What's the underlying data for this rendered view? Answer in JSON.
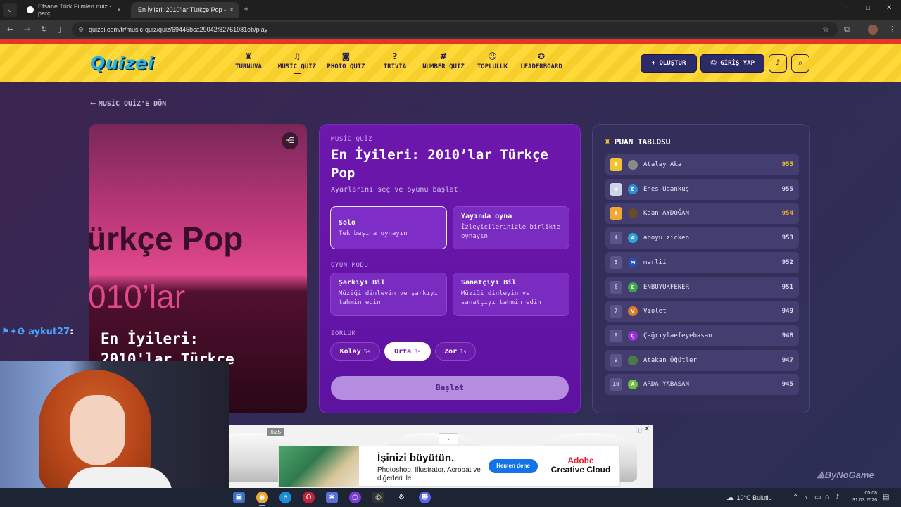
{
  "browser": {
    "tabs": [
      {
        "title": "Efsane Türk Filmleri quiz - parç",
        "close": "×"
      },
      {
        "title": "En İyileri: 2010'lar Türkçe Pop -",
        "close": "×"
      }
    ],
    "tab_dropdown_icon": "chevron-down-icon",
    "new_tab": "+",
    "window_controls": [
      "–",
      "□",
      "✕"
    ],
    "url": "quizei.com/tr/music-quiz/quiz/69445bca29042f82761981eb/play"
  },
  "site": {
    "logo": "Quizei",
    "nav": [
      {
        "label": "TURNUVA",
        "icon": "trophy-icon",
        "glyph": "♜"
      },
      {
        "label": "MUSİC QUİZ",
        "icon": "music-icon",
        "glyph": "♫",
        "active": true
      },
      {
        "label": "PHOTO QUİZ",
        "icon": "camera-icon",
        "glyph": "◙"
      },
      {
        "label": "TRİVİA",
        "icon": "question-icon",
        "glyph": "?"
      },
      {
        "label": "NUMBER QUİZ",
        "icon": "hash-icon",
        "glyph": "#"
      },
      {
        "label": "TOPLULUK",
        "icon": "users-icon",
        "glyph": "☺"
      },
      {
        "label": "LEADERBOARD",
        "icon": "award-icon",
        "glyph": "✪"
      }
    ],
    "create_button": "+ OLUŞTUR",
    "login_button": "GİRİŞ YAP",
    "colors": {
      "header_yellow": "#ffd83a",
      "accent_purple": "#6d17ad",
      "logo_blue": "#24b6e8"
    }
  },
  "page": {
    "back_link": "MUSİC QUİZ'E DÖN",
    "cover": {
      "line1": "ürkçe Pop",
      "line2": "010’lar",
      "title_line1": "En İyileri:",
      "title_line2": "2010'lar Türkçe"
    },
    "setup": {
      "kicker": "MUSİC QUİZ",
      "title": "En İyileri: 2010’lar Türkçe Pop",
      "subtitle": "Ayarlarını seç ve oyunu başlat.",
      "play_modes": [
        {
          "title": "Solo",
          "desc": "Tek başına oynayın",
          "selected": true
        },
        {
          "title": "Yayında oyna",
          "desc": "İzleyicilerinizle birlikte oynayın",
          "selected": false
        }
      ],
      "game_mode_label": "OYUN MODU",
      "game_modes": [
        {
          "title": "Şarkıyı Bil",
          "desc": "Müziği dinleyin ve şarkıyı tahmin edin"
        },
        {
          "title": "Sanatçıyı Bil",
          "desc": "Müziği dinleyin ve sanatçıyı tahmin edin"
        }
      ],
      "difficulty_label": "ZORLUK",
      "difficulties": [
        {
          "label": "Kolay",
          "time": "5s",
          "selected": false
        },
        {
          "label": "Orta",
          "time": "3s",
          "selected": true
        },
        {
          "label": "Zor",
          "time": "1s",
          "selected": false
        }
      ],
      "start_button": "Başlat"
    },
    "leaderboard": {
      "title": "PUAN TABLOSU",
      "rows": [
        {
          "rank": "",
          "rank_icon": "trophy-gold",
          "avatar": "",
          "avatar_color": "#8a8a8a",
          "name": "Atalay Aka",
          "score": "955",
          "highlight": "#f2c230"
        },
        {
          "rank": "",
          "rank_icon": "trophy-silver",
          "avatar": "E",
          "avatar_color": "#2f8fd8",
          "name": "Enes Ugankuş",
          "score": "955",
          "highlight": "#dcd9f0"
        },
        {
          "rank": "",
          "rank_icon": "trophy-bronze",
          "avatar": "",
          "avatar_color": "#6a4a2a",
          "name": "Kaan AYDOĞAN",
          "score": "954",
          "highlight": "#f2a830"
        },
        {
          "rank": "4",
          "avatar": "A",
          "avatar_color": "#2aa7d8",
          "name": "apoyu zicken",
          "score": "953"
        },
        {
          "rank": "5",
          "avatar": "M",
          "avatar_color": "#2a4fb0",
          "name": "merlii",
          "score": "952"
        },
        {
          "rank": "6",
          "avatar": "E",
          "avatar_color": "#39a84a",
          "name": "ENBUYUKFENER",
          "score": "951"
        },
        {
          "rank": "7",
          "avatar": "V",
          "avatar_color": "#e07a2a",
          "name": "Violet",
          "score": "949"
        },
        {
          "rank": "8",
          "avatar": "Ç",
          "avatar_color": "#9a2fd0",
          "name": "Çağrıylaefeyebasan",
          "score": "948"
        },
        {
          "rank": "9",
          "avatar": "",
          "avatar_color": "#4a7a4a",
          "name": "Atakan Öğütler",
          "score": "947"
        },
        {
          "rank": "10",
          "avatar": "A",
          "avatar_color": "#6cc23a",
          "name": "ARDA YABASAN",
          "score": "945"
        }
      ]
    }
  },
  "ad": {
    "discount": "%35",
    "headline": "İşinizi büyütün.",
    "body": "Photoshop, Illustrator, Acrobat ve diğerleri ile.",
    "cta": "Hemen dene",
    "brand_top": "Adobe",
    "brand_bottom": "Creative Cloud",
    "close": "✕"
  },
  "overlay": {
    "chat_user": "aykut27",
    "chat_colon": ":",
    "watermark": "ByNoGame"
  },
  "taskbar": {
    "weather": "10°C Bulutlu",
    "time": "05:08",
    "date": "31.03.2026"
  }
}
